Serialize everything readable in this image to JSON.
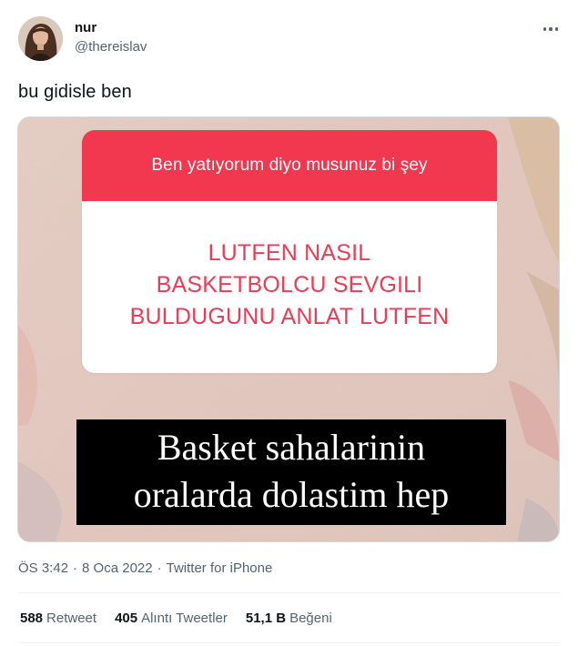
{
  "user": {
    "name": "nur",
    "handle": "@thereislav"
  },
  "tweet": {
    "text": "bu gidisle ben"
  },
  "media": {
    "question_header": "Ben yatıyorum diyo musunuz bi şey",
    "question_lines": [
      "LUTFEN NASIL",
      "BASKETBOLCU SEVGILI",
      "BULDUGUNU ANLAT LUTFEN"
    ],
    "caption_lines": [
      "Basket sahalarinin",
      "oralarda dolastim hep"
    ]
  },
  "meta": {
    "time": "ÖS 3:42",
    "date": "8 Oca 2022",
    "source": "Twitter for iPhone",
    "separator": "·"
  },
  "stats": {
    "retweets_count": "588",
    "retweets_label": "Retweet",
    "quotes_count": "405",
    "quotes_label": "Alıntı Tweetler",
    "likes_count": "51,1 B",
    "likes_label": "Beğeni"
  },
  "colors": {
    "question_red": "#f2384f",
    "question_text": "#eb3b55",
    "secondary_text": "#536471",
    "primary_text": "#0f1419"
  }
}
